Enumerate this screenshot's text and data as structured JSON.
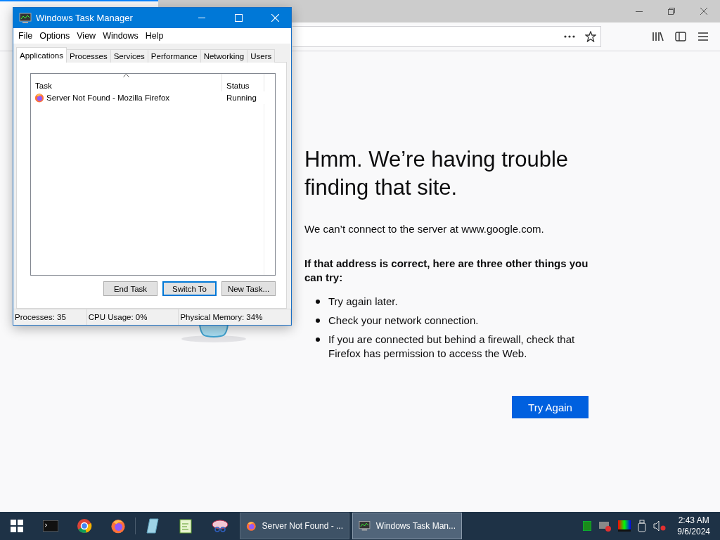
{
  "browser": {
    "page": {
      "heading": "Hmm. We’re having trouble finding that site.",
      "message": "We can’t connect to the server at www.google.com.",
      "advice_title": "If that address is correct, here are three other things you can try:",
      "suggestions": [
        "Try again later.",
        "Check your network connection.",
        "If you are connected but behind a firewall, check that Firefox has permission to access the Web."
      ],
      "button": "Try Again"
    }
  },
  "task_manager": {
    "title": "Windows Task Manager",
    "menu": [
      "File",
      "Options",
      "View",
      "Windows",
      "Help"
    ],
    "tabs": [
      {
        "label": "Applications",
        "selected": true
      },
      {
        "label": "Processes",
        "selected": false
      },
      {
        "label": "Services",
        "selected": false
      },
      {
        "label": "Performance",
        "selected": false
      },
      {
        "label": "Networking",
        "selected": false
      },
      {
        "label": "Users",
        "selected": false
      }
    ],
    "columns": [
      "Task",
      "Status"
    ],
    "rows": [
      {
        "task": "Server Not Found - Mozilla Firefox",
        "status": "Running"
      }
    ],
    "buttons": [
      {
        "label": "End Task",
        "focused": false
      },
      {
        "label": "Switch To",
        "focused": true
      },
      {
        "label": "New Task...",
        "focused": false
      }
    ],
    "status_bar": [
      "Processes: 35",
      "CPU Usage: 0%",
      "Physical Memory: 34%"
    ]
  },
  "taskbar": {
    "windows": [
      {
        "kind": "firefox",
        "label": "Server Not Found - ...",
        "selected": false
      },
      {
        "kind": "taskmgr",
        "label": "Windows Task Man...",
        "selected": true
      }
    ],
    "clock": {
      "time": "2:43 AM",
      "date": "9/6/2024"
    }
  }
}
